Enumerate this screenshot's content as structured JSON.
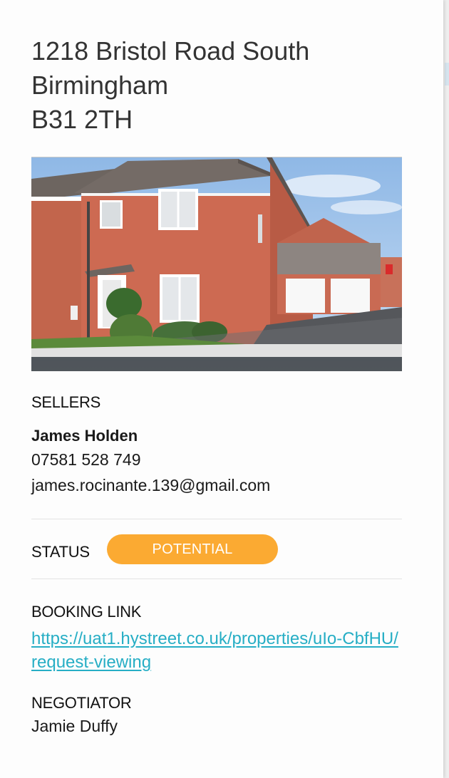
{
  "property": {
    "address_lines": [
      "1218 Bristol Road South",
      "Birmingham",
      "B31 2TH"
    ],
    "photo_alt": "House photo"
  },
  "sellers": {
    "heading": "SELLERS",
    "name": "James Holden",
    "phone": "07581 528 749",
    "email": "james.rocinante.139@gmail.com"
  },
  "status": {
    "heading": "STATUS",
    "value": "POTENTIAL",
    "color": "#fbaa32"
  },
  "booking": {
    "heading": "BOOKING LINK",
    "url": "https://uat1.hystreet.co.uk/properties/uIo-CbfHU/request-viewing"
  },
  "negotiator": {
    "heading": "NEGOTIATOR",
    "name": "Jamie Duffy"
  },
  "colors": {
    "accent_link": "#26aec5",
    "status_badge": "#fbaa32"
  }
}
